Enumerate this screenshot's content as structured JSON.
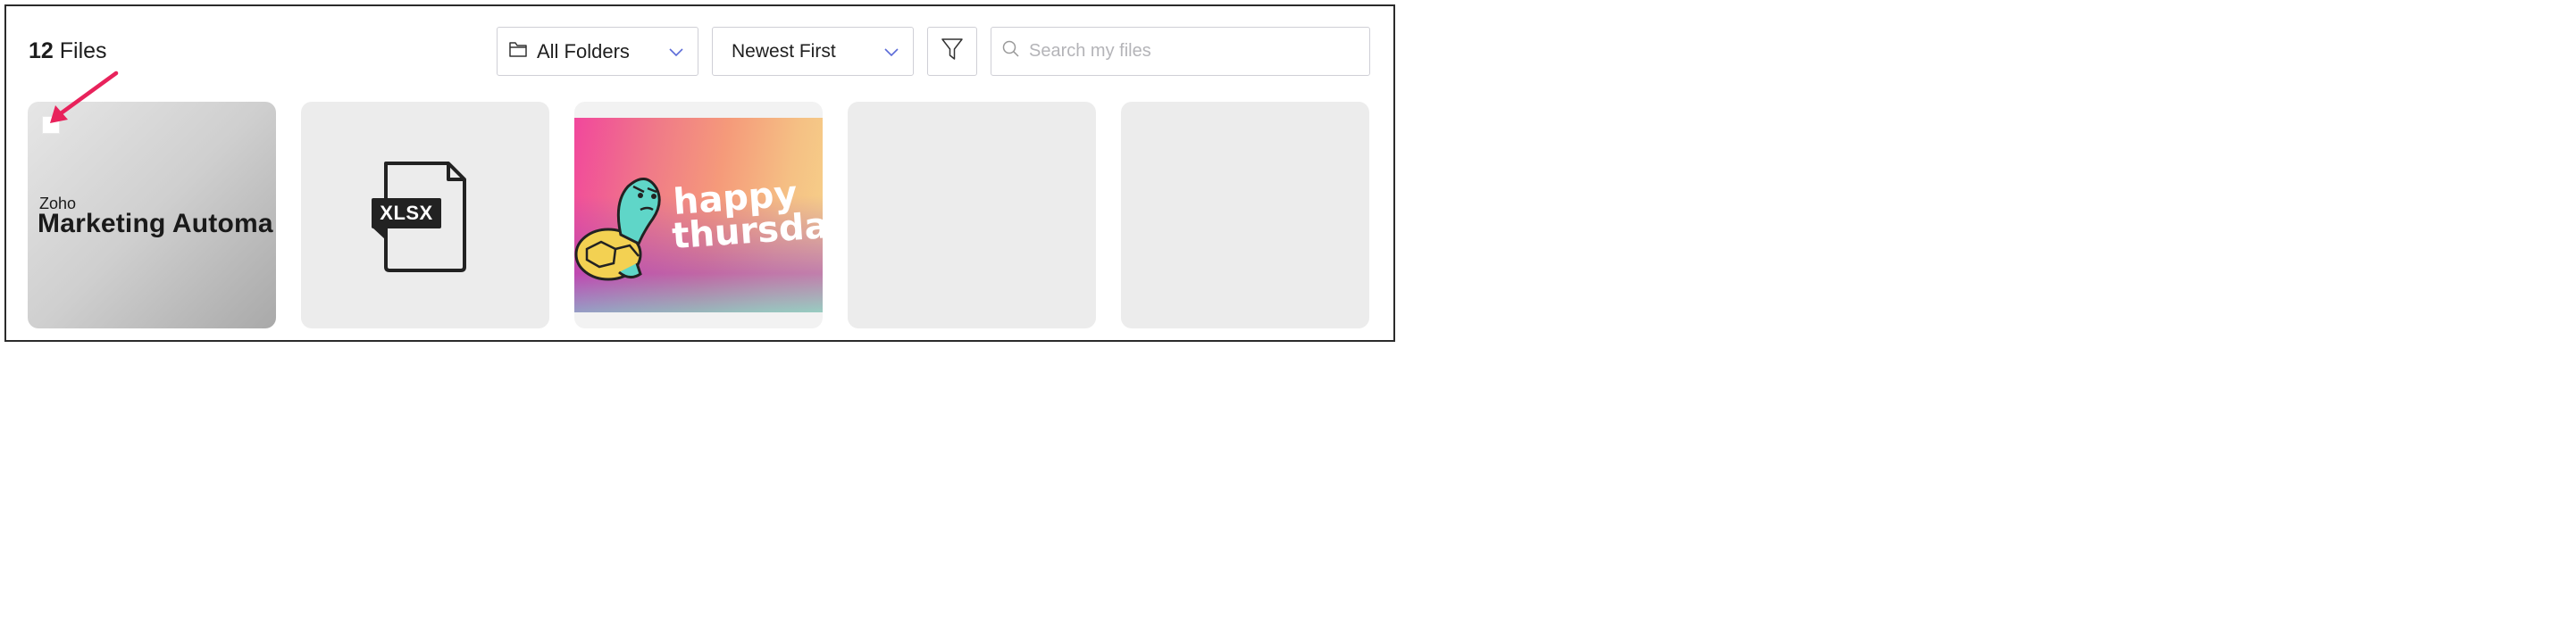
{
  "header": {
    "count": "12",
    "files_label": "Files"
  },
  "toolbar": {
    "folders_label": "All Folders",
    "sort_label": "Newest First",
    "search_placeholder": "Search my files"
  },
  "files": [
    {
      "brand": "Zoho",
      "title": "Marketing Automa"
    },
    {
      "file_type": "XLSX"
    },
    {
      "thumb_line1": "happy",
      "thumb_line2": "thursda"
    },
    {},
    {}
  ],
  "colors": {
    "annotation_arrow": "#e8225b",
    "card_background": "#ececec",
    "control_border": "#cfcfd6",
    "chevron": "#5b6bd8"
  }
}
